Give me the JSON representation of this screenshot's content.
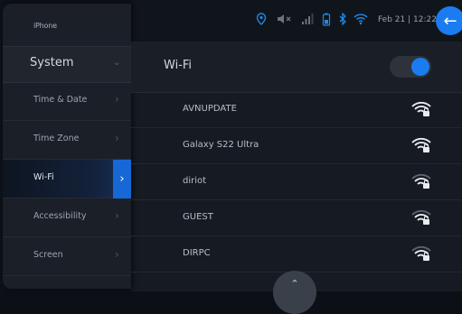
{
  "device": {
    "label": "iPhone"
  },
  "status": {
    "datetime": "Feb 21 | 12:22",
    "icons": [
      "location-icon",
      "mute-icon",
      "signal-icon",
      "battery-icon",
      "bluetooth-icon",
      "wifi-icon"
    ],
    "accent": "#1a7cf0"
  },
  "sidebar": {
    "header": "System",
    "items": [
      {
        "label": "Time & Date"
      },
      {
        "label": "Time Zone"
      },
      {
        "label": "Wi-Fi",
        "active": true
      },
      {
        "label": "Accessibility"
      },
      {
        "label": "Screen"
      }
    ]
  },
  "wifi": {
    "title": "Wi-Fi",
    "enabled": true,
    "networks": [
      {
        "name": "AVNUPDATE",
        "secured": true,
        "signal": "full"
      },
      {
        "name": "Galaxy S22 Ultra",
        "secured": true,
        "signal": "full"
      },
      {
        "name": "diriot",
        "secured": true,
        "signal": "medium"
      },
      {
        "name": "GUEST",
        "secured": true,
        "signal": "medium"
      },
      {
        "name": "DIRPC",
        "secured": true,
        "signal": "medium"
      }
    ]
  },
  "controls": {
    "scroll_up_icon": "chevron-up-icon",
    "back_icon": "back-arrow-icon"
  }
}
